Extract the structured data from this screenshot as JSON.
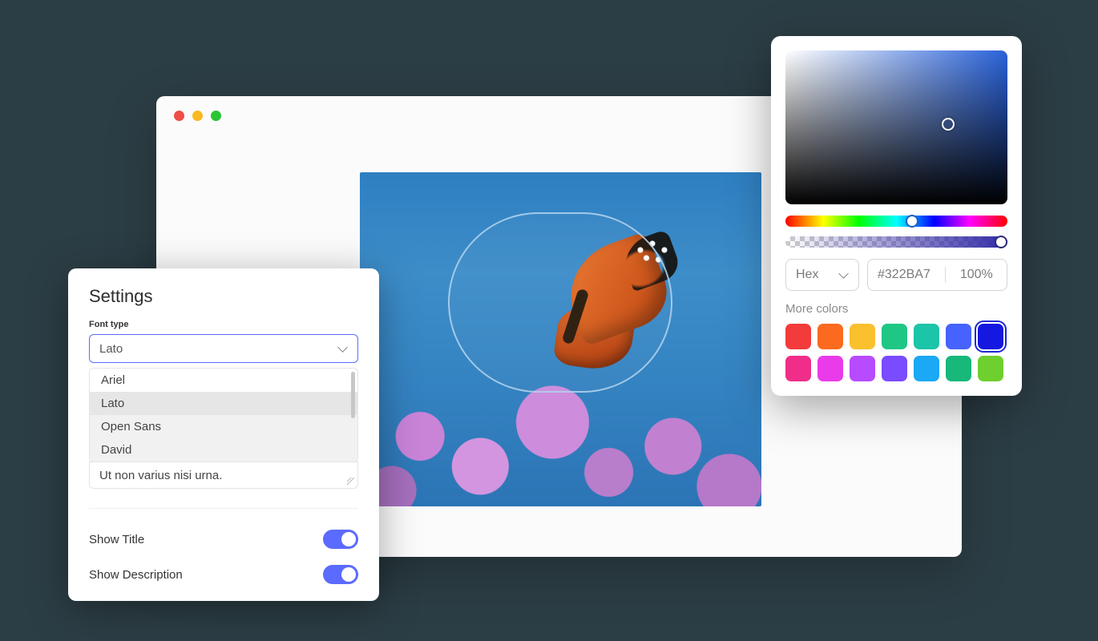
{
  "settings": {
    "title": "Settings",
    "font_type_label": "Font type",
    "font_selected": "Lato",
    "font_options": [
      "Ariel",
      "Lato",
      "Open Sans",
      "David"
    ],
    "selected_index": 1,
    "textarea_value": "Ut non varius nisi urna.",
    "toggles": [
      {
        "label": "Show Title",
        "on": true
      },
      {
        "label": "Show Description",
        "on": true
      }
    ]
  },
  "color_picker": {
    "format_label": "Hex",
    "hex_value": "#322BA7",
    "opacity_label": "100%",
    "more_colors_label": "More colors",
    "swatches": [
      {
        "color": "#f43b3b"
      },
      {
        "color": "#fb6a1e"
      },
      {
        "color": "#fac02e"
      },
      {
        "color": "#1ec884"
      },
      {
        "color": "#1cc4a8"
      },
      {
        "color": "#4763ff"
      },
      {
        "color": "#1518e0",
        "selected": true
      },
      {
        "color": "#f02e8a"
      },
      {
        "color": "#e93be9"
      },
      {
        "color": "#b74bff"
      },
      {
        "color": "#7a4bff"
      },
      {
        "color": "#1ba8f5"
      },
      {
        "color": "#17b87a"
      },
      {
        "color": "#6fcf2e"
      }
    ]
  }
}
